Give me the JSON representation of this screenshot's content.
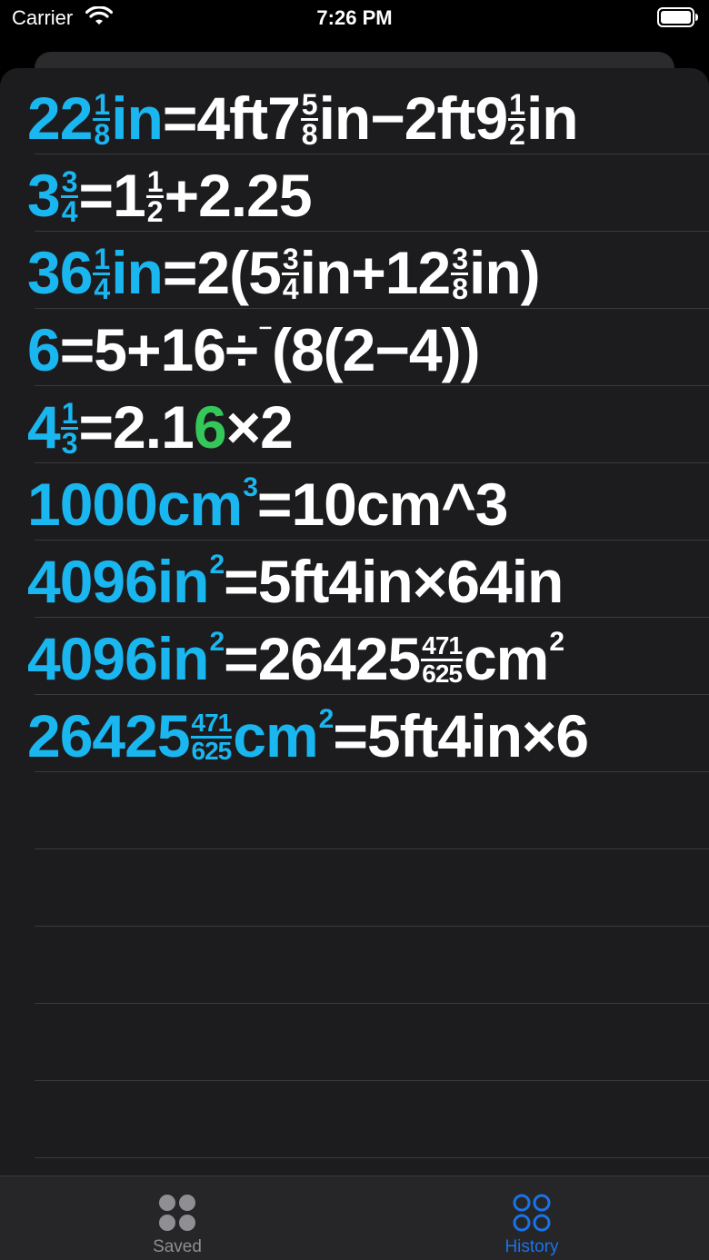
{
  "status_bar": {
    "carrier": "Carrier",
    "time": "7:26 PM"
  },
  "colors": {
    "result": "#1ab6f0",
    "expression": "#ffffff",
    "repeating_digit": "#34c759",
    "active_tab": "#1a73e8",
    "inactive_tab": "#8e8e93"
  },
  "history": {
    "row1": {
      "r_a": "22",
      "r_f_num": "1",
      "r_f_den": "8",
      "r_b": "in",
      "e_a": "=4ft7",
      "e_f1_num": "5",
      "e_f1_den": "8",
      "e_b": "in−2ft9",
      "e_f2_num": "1",
      "e_f2_den": "2",
      "e_c": "in"
    },
    "row2": {
      "r_a": "3",
      "r_f_num": "3",
      "r_f_den": "4",
      "e_a": "=1",
      "e_f_num": "1",
      "e_f_den": "2",
      "e_b": "+2.25"
    },
    "row3": {
      "r_a": "36",
      "r_f_num": "1",
      "r_f_den": "4",
      "r_b": "in",
      "e_a": "=2(5",
      "e_f1_num": "3",
      "e_f1_den": "4",
      "e_b": "in+12",
      "e_f2_num": "3",
      "e_f2_den": "8",
      "e_c": "in)"
    },
    "row4": {
      "r_a": "6",
      "e_a": "=5+16÷",
      "e_neg": "⁻",
      "e_b": "(8(2−4))"
    },
    "row5": {
      "r_a": "4",
      "r_f_num": "1",
      "r_f_den": "3",
      "e_a": "=2.1",
      "e_rep": "6",
      "e_b": "×2"
    },
    "row6": {
      "r_a": "1000cm",
      "r_sup": "3",
      "e_a": "=10cm^3"
    },
    "row7": {
      "r_a": "4096in",
      "r_sup": "2",
      "e_a": "=5ft4in×64in"
    },
    "row8": {
      "r_a": "4096in",
      "r_sup": "2",
      "e_a": "=26425",
      "e_f_num": "471",
      "e_f_den": "625",
      "e_b": "cm",
      "e_sup": "2"
    },
    "row9": {
      "r_a": "26425",
      "r_f_num": "471",
      "r_f_den": "625",
      "r_b": "cm",
      "r_sup": "2",
      "e_a": "=5ft4in×6"
    }
  },
  "tabs": {
    "saved": {
      "label": "Saved",
      "icon": "grid-four-filled-circles-icon"
    },
    "history": {
      "label": "History",
      "icon": "grid-four-outline-circles-icon"
    }
  }
}
